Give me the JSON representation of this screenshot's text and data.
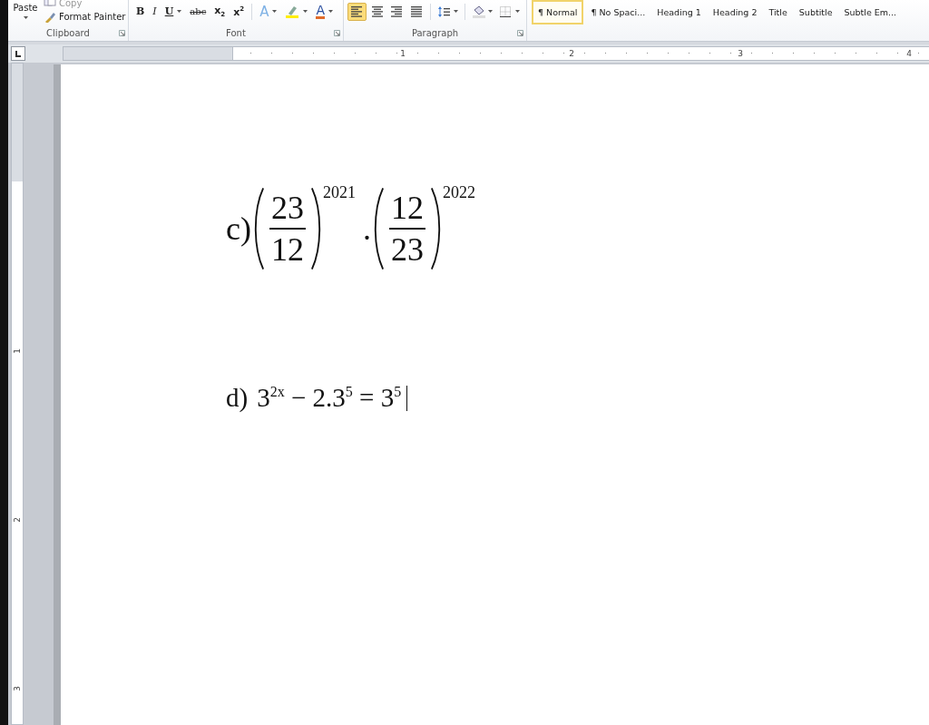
{
  "ribbon": {
    "clipboard": {
      "paste": "Paste",
      "copy": "Copy",
      "format_painter": "Format Painter",
      "label": "Clipboard"
    },
    "font": {
      "label": "Font",
      "buttons": [
        {
          "kind": "bold",
          "label": "B",
          "dropdown": false
        },
        {
          "kind": "italic",
          "label": "I",
          "dropdown": false
        },
        {
          "kind": "underline",
          "label": "U",
          "dropdown": true
        },
        {
          "kind": "strike",
          "label": "abc",
          "dropdown": false
        },
        {
          "kind": "sub",
          "label": "x",
          "mark": "2",
          "dropdown": false
        },
        {
          "kind": "sup",
          "label": "x",
          "mark": "2",
          "dropdown": false
        },
        {
          "kind": "effects",
          "label": "A",
          "dropdown": true
        },
        {
          "kind": "highlight",
          "dropdown": true
        },
        {
          "kind": "color",
          "label": "A",
          "dropdown": true
        }
      ]
    },
    "paragraph": {
      "label": "Paragraph",
      "buttons": [
        {
          "kind": "align-left",
          "selected": true,
          "dropdown": false
        },
        {
          "kind": "align-center",
          "selected": false,
          "dropdown": false
        },
        {
          "kind": "align-right",
          "selected": false,
          "dropdown": false
        },
        {
          "kind": "justify",
          "selected": false,
          "dropdown": false
        },
        {
          "kind": "line-spacing",
          "selected": false,
          "dropdown": true
        },
        {
          "kind": "shading",
          "selected": false,
          "dropdown": true
        },
        {
          "kind": "borders",
          "selected": false,
          "dropdown": true
        }
      ]
    },
    "styles": [
      {
        "label": "¶ Normal",
        "selected": true
      },
      {
        "label": "¶ No Spaci...",
        "selected": false
      },
      {
        "label": "Heading 1",
        "selected": false
      },
      {
        "label": "Heading 2",
        "selected": false
      },
      {
        "label": "Title",
        "selected": false
      },
      {
        "label": "Subtitle",
        "selected": false
      },
      {
        "label": "Subtle Em...",
        "selected": false
      }
    ]
  },
  "ruler": {
    "horizontal_labels": [
      "1",
      "2",
      "3",
      "4"
    ],
    "vertical_labels": [
      "1",
      "2",
      "3"
    ]
  },
  "document": {
    "expressions": [
      {
        "kind": "power_product",
        "label": "c)",
        "operator": ".",
        "factors": [
          {
            "numerator": "23",
            "denominator": "12",
            "exponent": "2021"
          },
          {
            "numerator": "12",
            "denominator": "23",
            "exponent": "2022"
          }
        ]
      },
      {
        "kind": "equation",
        "label": "d)",
        "text": "3$^{2x}$ − 2.3$^{5}$ = 3$^{5}$",
        "caret": true
      }
    ]
  }
}
